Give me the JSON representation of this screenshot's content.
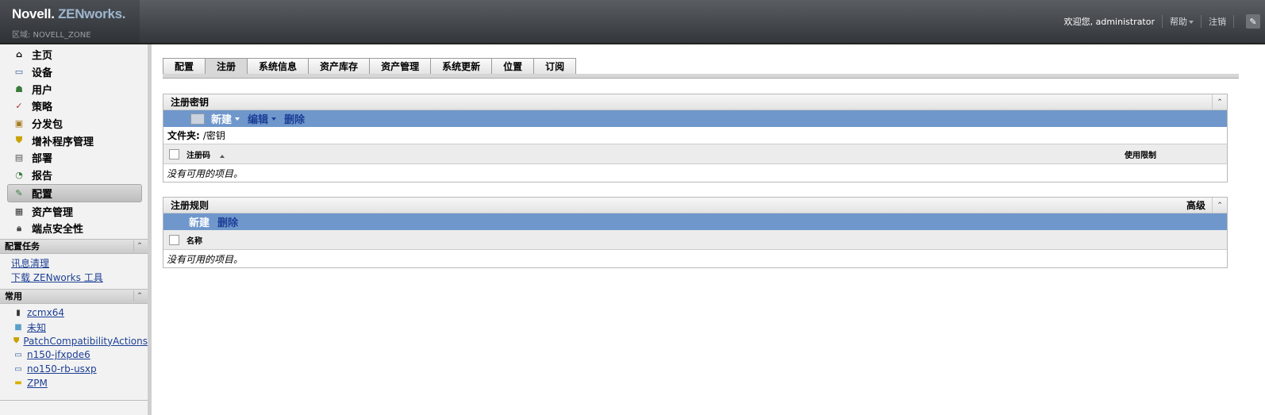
{
  "header": {
    "logo_prefix": "Novell.",
    "logo_product": "ZENworks.",
    "zone": "区域: NOVELL_ZONE",
    "welcome": "欢迎您, administrator",
    "help": "帮助",
    "logout": "注销"
  },
  "sidebar": {
    "nav": [
      {
        "label": "主页",
        "icon": "home-icon"
      },
      {
        "label": "设备",
        "icon": "monitor-icon"
      },
      {
        "label": "用户",
        "icon": "users-icon"
      },
      {
        "label": "策略",
        "icon": "policy-icon"
      },
      {
        "label": "分发包",
        "icon": "bundle-icon"
      },
      {
        "label": "增补程序管理",
        "icon": "shield-icon"
      },
      {
        "label": "部署",
        "icon": "deploy-icon"
      },
      {
        "label": "报告",
        "icon": "report-icon"
      },
      {
        "label": "配置",
        "icon": "wrench-icon"
      },
      {
        "label": "资产管理",
        "icon": "asset-icon"
      },
      {
        "label": "端点安全性",
        "icon": "lock-icon"
      }
    ],
    "tasks_title": "配置任务",
    "tasks": [
      "讯息清理",
      "下载 ZENworks 工具"
    ],
    "favorites_title": "常用",
    "favorites": [
      {
        "label": "zcmx64",
        "icon": "server-icon"
      },
      {
        "label": "未知",
        "icon": "cube-icon"
      },
      {
        "label": "PatchCompatibilityActions",
        "icon": "shield-icon"
      },
      {
        "label": "n150-jfxpde6",
        "icon": "monitor-icon"
      },
      {
        "label": "no150-rb-usxp",
        "icon": "monitor-icon"
      },
      {
        "label": "ZPM",
        "icon": "folder-icon"
      }
    ]
  },
  "tabs": [
    {
      "label": "配置",
      "active": false
    },
    {
      "label": "注册",
      "active": true
    },
    {
      "label": "系统信息",
      "active": false
    },
    {
      "label": "资产库存",
      "active": false
    },
    {
      "label": "资产管理",
      "active": false
    },
    {
      "label": "系统更新",
      "active": false
    },
    {
      "label": "位置",
      "active": false
    },
    {
      "label": "订阅",
      "active": false
    }
  ],
  "keys_panel": {
    "title": "注册密钥",
    "new": "新建",
    "edit": "编辑",
    "delete": "删除",
    "folder_label": "文件夹:",
    "folder_path": "/密钥",
    "col_code": "注册码",
    "col_usage": "使用限制",
    "empty": "没有可用的项目。"
  },
  "rules_panel": {
    "title": "注册规则",
    "advanced": "高级",
    "new": "新建",
    "delete": "删除",
    "col_name": "名称",
    "empty": "没有可用的项目。"
  }
}
